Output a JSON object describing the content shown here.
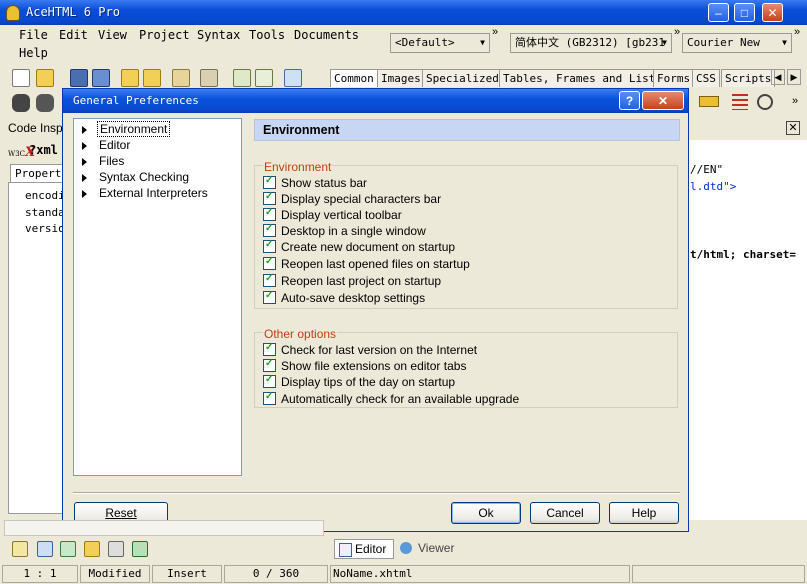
{
  "app": {
    "title": "AceHTML 6 Pro"
  },
  "menubar": [
    "File",
    "Edit",
    "View",
    "Project",
    "Syntax",
    "Tools",
    "Documents",
    "Help"
  ],
  "toolbar": {
    "doctype": "<Default>",
    "encoding": "简体中文 (GB2312) [gb231",
    "font": "Courier New"
  },
  "snippet_tabs": [
    "Common",
    "Images",
    "Specialized",
    "Tables, Frames and Lists",
    "Forms",
    "CSS",
    "Scripts"
  ],
  "left_panel": {
    "title": "Code Inspe",
    "xml_label": "?xml",
    "tab": "Properti",
    "props": [
      "encodi",
      "standa",
      "versio"
    ]
  },
  "editor_lines": [
    "//EN\"",
    "l.dtd\">",
    "t/html; charset="
  ],
  "dialog": {
    "title": "General Preferences",
    "tree": [
      "Environment",
      "Editor",
      "Files",
      "Syntax Checking",
      "External Interpreters"
    ],
    "panel_title": "Environment",
    "group1": {
      "title": "Environment",
      "items": [
        "Show status bar",
        "Display special characters bar",
        "Display vertical toolbar",
        "Desktop in a single window",
        "Create new document on startup",
        "Reopen last opened files on startup",
        "Reopen last project on startup",
        "Auto-save desktop settings"
      ]
    },
    "group2": {
      "title": "Other options",
      "items": [
        "Check for last version on the Internet",
        "Show file extensions on editor tabs",
        "Display tips of the day on startup",
        "Automatically check for an available upgrade"
      ]
    },
    "buttons": {
      "reset": "Reset",
      "ok": "Ok",
      "cancel": "Cancel",
      "help": "Help"
    }
  },
  "bottom_tabs": {
    "editor": "Editor",
    "viewer": "Viewer"
  },
  "statusbar": {
    "position": "1 : 1",
    "modified": "Modified",
    "mode": "Insert",
    "size": "0 / 360",
    "filename": "NoName.xhtml"
  }
}
